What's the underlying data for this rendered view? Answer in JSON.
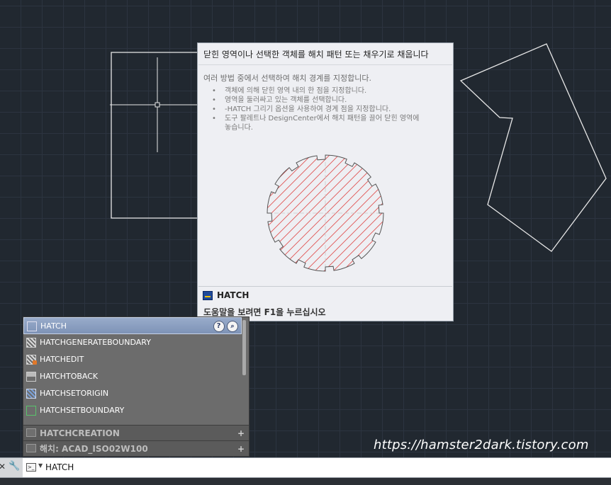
{
  "tooltip": {
    "title": "닫힌 영역이나 선택한 객체를 해치 패턴 또는 채우기로 채웁니다",
    "description": "여러 방법 중에서 선택하여 해치 경계를 지정합니다.",
    "bullets": [
      "객체에 의해 닫힌 영역 내의 한 점을 지정합니다.",
      "영역을 둘러싸고 있는 객체를 선택합니다.",
      "-HATCH 그리기 옵션을 사용하여 경계 점을 지정합니다.",
      "도구 팔레트나 DesignCenter에서 해치 패턴을 끌어 닫힌 영역에",
      "놓습니다."
    ],
    "command_name": "HATCH",
    "help_hint": "도움말을 보려면 F1을 누르십시오"
  },
  "autocomplete": {
    "items": [
      {
        "label": "HATCH",
        "icon": "hatch-icon"
      },
      {
        "label": "HATCHGENERATEBOUNDARY",
        "icon": "hatch-generate-boundary-icon"
      },
      {
        "label": "HATCHEDIT",
        "icon": "hatch-edit-icon"
      },
      {
        "label": "HATCHTOBACK",
        "icon": "hatch-to-back-icon"
      },
      {
        "label": "HATCHSETORIGIN",
        "icon": "hatch-set-origin-icon"
      },
      {
        "label": "HATCHSETBOUNDARY",
        "icon": "hatch-set-boundary-icon"
      }
    ],
    "help_button": "?",
    "sections": [
      {
        "label": "HATCHCREATION",
        "expand": "+"
      },
      {
        "label": "해치: ACAD_ISO02W100",
        "expand": "+"
      }
    ]
  },
  "watermark": "https://hamster2dark.tistory.com",
  "command_line": {
    "close": "✕",
    "customize": "🔧",
    "value": "HATCH"
  },
  "colors": {
    "canvas_bg": "#212830",
    "hatch_red": "#e05252",
    "selection": "#8a9fc2"
  }
}
